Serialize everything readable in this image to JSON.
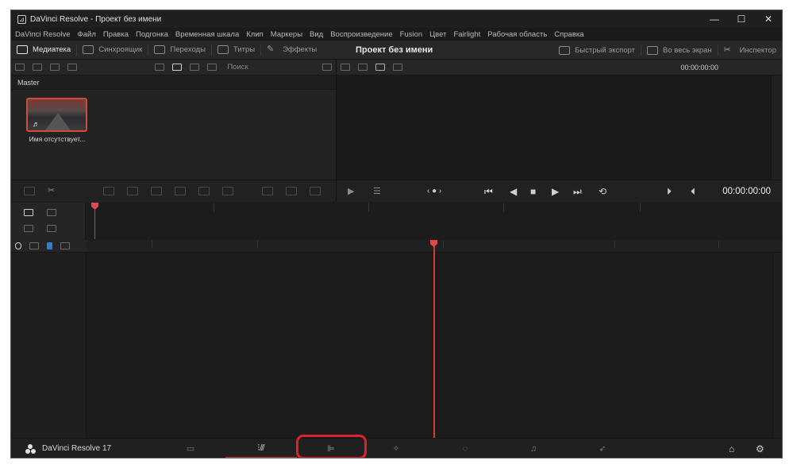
{
  "window": {
    "title": "DaVinci Resolve - Проект без имени",
    "controls": [
      "—",
      "☐",
      "✕"
    ]
  },
  "menu": [
    "DaVinci Resolve",
    "Файл",
    "Правка",
    "Подгонка",
    "Временная шкала",
    "Клип",
    "Маркеры",
    "Вид",
    "Воспроизведение",
    "Fusion",
    "Цвет",
    "Fairlight",
    "Рабочая область",
    "Справка"
  ],
  "toolbar": {
    "media_pool": "Медиатека",
    "sync": "Синхроящик",
    "transitions": "Переходы",
    "titles": "Титры",
    "effects": "Эффекты",
    "project_name": "Проект без имени",
    "quick_export": "Быстрый экспорт",
    "fullscreen": "Во весь экран",
    "inspector": "Инспектор"
  },
  "media_pool": {
    "search_placeholder": "Поиск",
    "bin_title": "Master",
    "clip_name": "Имя отсутствует...",
    "clip_audio_icon": "♬"
  },
  "viewer": {
    "header_timecode": "00:00:00:00",
    "transport_timecode": "00:00:00:00"
  },
  "page_bar": {
    "brand": "DaVinci Resolve 17",
    "pages": [
      "media-page",
      "cut-page",
      "edit-page",
      "fusion-page",
      "color-page",
      "fairlight-page",
      "deliver-page"
    ],
    "active_page": "cut-page",
    "highlighted_page": "edit-page"
  },
  "colors": {
    "accent_red": "#d23a3a",
    "highlight_red": "#e0202a",
    "window_bg": "#1e1e1f"
  }
}
